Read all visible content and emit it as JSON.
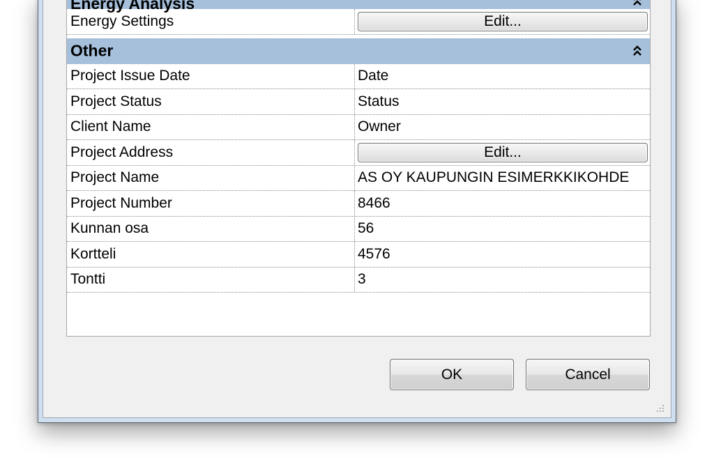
{
  "groups": {
    "energy": {
      "title": "Energy Analysis",
      "rows": {
        "energy_settings": {
          "label": "Energy Settings",
          "button": "Edit..."
        }
      }
    },
    "other": {
      "title": "Other",
      "rows": {
        "issue_date": {
          "label": "Project Issue Date",
          "value": "Date"
        },
        "status": {
          "label": "Project Status",
          "value": "Status"
        },
        "client": {
          "label": "Client Name",
          "value": "Owner"
        },
        "address": {
          "label": "Project Address",
          "button": "Edit..."
        },
        "name": {
          "label": "Project Name",
          "value": "AS OY KAUPUNGIN ESIMERKKIKOHDE"
        },
        "number": {
          "label": "Project Number",
          "value": "8466"
        },
        "kunnan_osa": {
          "label": "Kunnan osa",
          "value": "56"
        },
        "kortteli": {
          "label": "Kortteli",
          "value": "4576"
        },
        "tontti": {
          "label": "Tontti",
          "value": "3"
        }
      }
    }
  },
  "buttons": {
    "ok": "OK",
    "cancel": "Cancel"
  },
  "icons": {
    "collapse": "double-chevron-up-icon",
    "grip": "resize-grip-icon"
  },
  "colors": {
    "group_header": "#a6c0dc",
    "window_frame": "#cfdff0",
    "client_bg": "#f0f0f0"
  }
}
